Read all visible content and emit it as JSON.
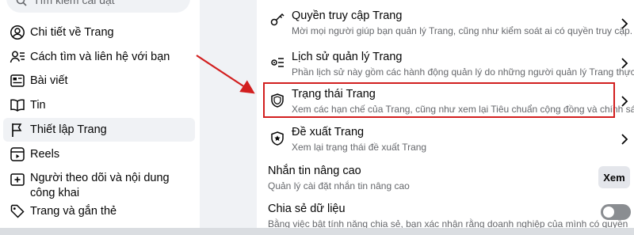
{
  "search": {
    "placeholder": "Tìm kiếm cài đặt"
  },
  "sidebar": {
    "items": [
      {
        "label": "Chi tiết về Trang",
        "icon": "user-circle-icon"
      },
      {
        "label": "Cách tìm và liên hệ với bạn",
        "icon": "user-contact-icon"
      },
      {
        "label": "Bài viết",
        "icon": "posts-icon"
      },
      {
        "label": "Tin",
        "icon": "book-icon"
      },
      {
        "label": "Thiết lập Trang",
        "icon": "flag-icon",
        "active": true
      },
      {
        "label": "Reels",
        "icon": "reels-icon"
      },
      {
        "label": "Người theo dõi và nội dung công khai",
        "icon": "follow-icon"
      },
      {
        "label": "Trang và gắn thẻ",
        "icon": "tag-icon"
      }
    ]
  },
  "main": {
    "rows": [
      {
        "title": "Quyền truy cập Trang",
        "desc": "Mời mọi người giúp bạn quản lý Trang, cũng như kiểm soát ai có quyền truy cập.",
        "icon": "key-icon"
      },
      {
        "title": "Lịch sử quản lý Trang",
        "desc": "Phần lịch sử này gồm các hành động quản lý do những người quản lý Trang thực hiện.",
        "icon": "settings-list-icon"
      },
      {
        "title": "Trạng thái Trang",
        "desc": "Xem các hạn chế của Trang, cũng như xem lại Tiêu chuẩn cộng đồng và chính sách.",
        "icon": "shield-icon"
      },
      {
        "title": "Đề xuất Trang",
        "desc": "Xem lại trạng thái đề xuất Trang",
        "icon": "star-badge-icon"
      }
    ],
    "messaging": {
      "title": "Nhắn tin nâng cao",
      "desc": "Quản lý cài đặt nhắn tin nâng cao",
      "button": "Xem"
    },
    "data_sharing": {
      "title": "Chia sẻ dữ liệu",
      "desc": "Bằng việc bật tính năng chia sẻ, bạn xác nhận rằng doanh nghiệp của mình có quyền",
      "toggle_on": false
    }
  },
  "colors": {
    "highlight": "#d21f1f",
    "muted": "#65676b"
  }
}
